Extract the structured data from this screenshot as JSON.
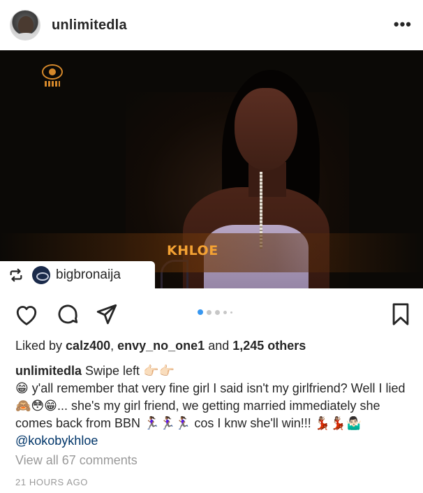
{
  "post": {
    "username": "unlimitedla",
    "more_icon": "more-horizontal-icon",
    "overlay_name": "KHLOE",
    "repost": {
      "icon": "repost-icon",
      "account": "bigbronaija"
    },
    "carousel": {
      "count": 5,
      "active_index": 0
    },
    "likes": {
      "prefix": "Liked by ",
      "user1": "calz400",
      "sep": ", ",
      "user2": "envy_no_one1",
      "and": " and ",
      "count": "1,245 others"
    },
    "caption": {
      "username": "unlimitedla",
      "line1_text": " Swipe left ",
      "line1_emoji": "👉🏻👉🏻",
      "emoji_grin": "😁",
      "text_a": " y'all remember that very fine girl I said isn't my girlfriend? Well I lied",
      "emoji_group": "🙈😳😁",
      "text_b": "... she's my girl friend, we getting married immediately she comes back from BBN ",
      "emoji_run": "🏃🏾‍♀️🏃🏾‍♀️🏃🏾‍♀️",
      "text_c": " cos I knw she'll win!!! ",
      "emoji_dance": "💃🏽💃🏽🤷🏻‍♂️",
      "mention": "@kokobykhloe"
    },
    "view_comments": "View all 67 comments",
    "timestamp": "21 HOURS AGO"
  },
  "colors": {
    "text": "#262626",
    "muted": "#999999",
    "link": "#003569",
    "active_dot": "#3897f0",
    "overlay_name": "#f4a233"
  }
}
